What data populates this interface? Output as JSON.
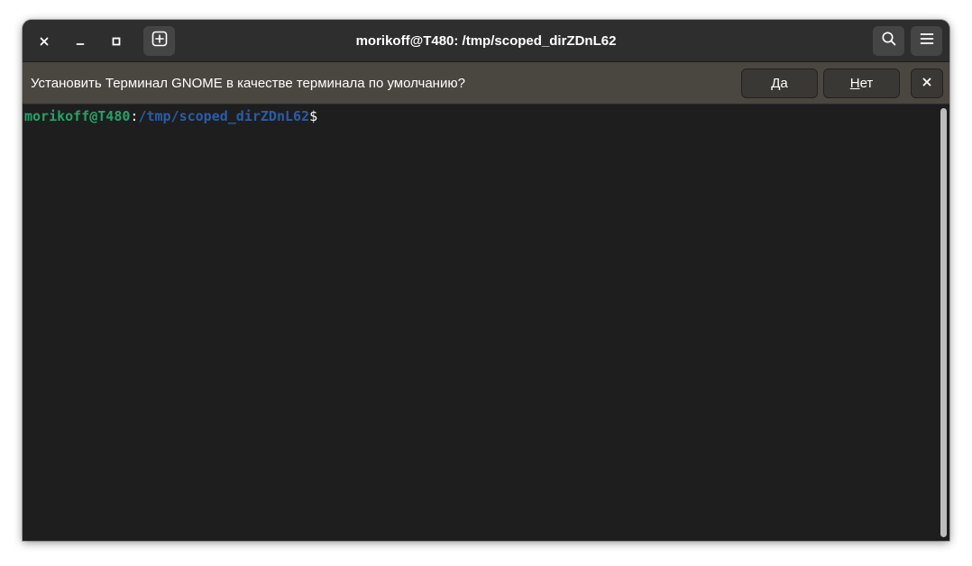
{
  "window": {
    "title": "morikoff@T480: /tmp/scoped_dirZDnL62"
  },
  "headerbar": {
    "close_icon": "close-icon",
    "minimize_icon": "minimize-icon",
    "maximize_icon": "maximize-icon",
    "new_tab_icon": "plus-square-icon",
    "search_icon": "search-icon",
    "menu_icon": "hamburger-menu-icon"
  },
  "infobar": {
    "message": "Установить Терминал GNOME в качестве терминала по умолчанию?",
    "yes_mnemonic": "Д",
    "yes_rest": "а",
    "no_mnemonic": "Н",
    "no_rest": "ет",
    "close_icon": "close-icon"
  },
  "terminal": {
    "user_host": "morikoff@T480",
    "separator": ":",
    "path": "/tmp/scoped_dirZDnL62",
    "prompt_symbol": "$"
  },
  "colors": {
    "headerbar_bg": "#2e2e2e",
    "infobar_bg": "#4a4640",
    "terminal_bg": "#1e1e1e",
    "prompt_user": "#26a269",
    "prompt_path": "#2a5da8"
  }
}
